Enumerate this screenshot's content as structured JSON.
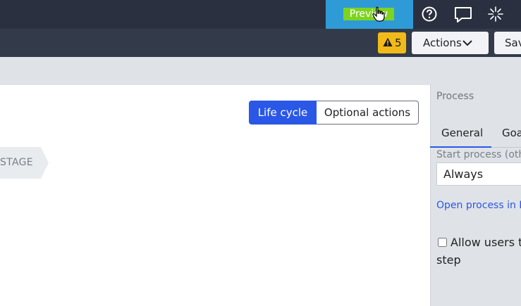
{
  "header": {
    "preview_label": "Preview",
    "icons": [
      "help-icon",
      "chat-icon",
      "loading-spinner-icon",
      "pointer-cursor-icon"
    ]
  },
  "toolbar": {
    "warning_count": "5",
    "actions_label": "Actions",
    "save_label": "Sav"
  },
  "canvas": {
    "segment": {
      "lifecycle_label": "Life cycle",
      "optional_label": "Optional actions",
      "selected": "Life cycle"
    },
    "stage_label": "STAGE"
  },
  "panel": {
    "title": "Process",
    "tabs": [
      {
        "label": "General",
        "active": true
      },
      {
        "label": "Goa",
        "active": false
      }
    ],
    "start_process_label": "Start process (oth",
    "start_process_value": "Always",
    "open_process_link": "Open process in D",
    "allow_users_line1": "Allow users to",
    "allow_users_line2": "step",
    "allow_users_checked": false
  },
  "colors": {
    "topbar": "#2b3040",
    "toolbar": "#333a4a",
    "preview_button": "#2e9bd6",
    "preview_highlight": "#7ed321",
    "warning_badge": "#f2b91a",
    "accent_blue": "#2a57e6",
    "panel_bg": "#dfe3e7"
  }
}
